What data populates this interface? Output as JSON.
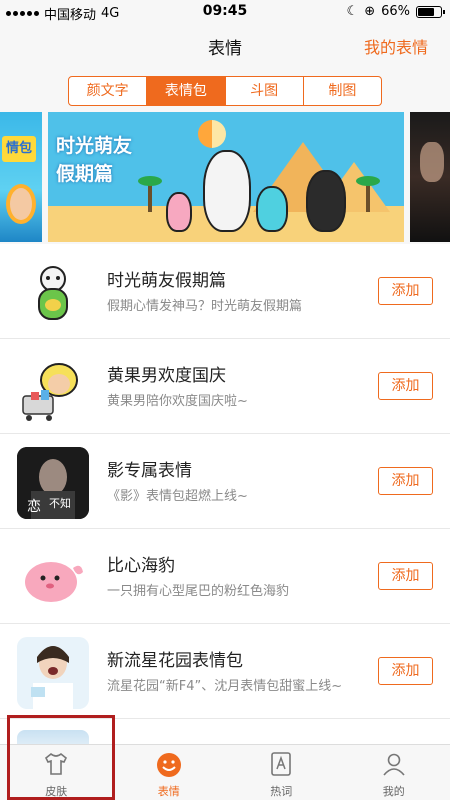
{
  "status_bar": {
    "carrier": "中国移动",
    "network": "4G",
    "time": "09:45",
    "battery": "66%"
  },
  "nav": {
    "title": "表情",
    "right_link": "我的表情"
  },
  "tabs": [
    {
      "label": "颜文字",
      "active": false
    },
    {
      "label": "表情包",
      "active": true
    },
    {
      "label": "斗图",
      "active": false
    },
    {
      "label": "制图",
      "active": false
    }
  ],
  "banner": {
    "left_tag": "情包",
    "headline": "时光萌友\n假期篇"
  },
  "list": [
    {
      "name": "时光萌友假期篇",
      "desc": "假期心情发神马？时光萌友假期篇",
      "button": "添加"
    },
    {
      "name": "黄果男欢度国庆",
      "desc": "黄果男陪你欢度国庆啦~",
      "button": "添加"
    },
    {
      "name": "影专属表情",
      "desc": "《影》表情包超燃上线~",
      "button": "添加"
    },
    {
      "name": "比心海豹",
      "desc": "一只拥有心型尾巴的粉红色海豹",
      "button": "添加"
    },
    {
      "name": "新流星花园表情包",
      "desc": "流星花园“新F4”、沈月表情包甜蜜上线~",
      "button": "添加"
    }
  ],
  "thumb_text": {
    "movie": "恋",
    "movie2": "不知"
  },
  "tabbar": [
    {
      "label": "皮肤",
      "icon": "tshirt-icon",
      "active": false
    },
    {
      "label": "表情",
      "icon": "smile-icon",
      "active": true
    },
    {
      "label": "热词",
      "icon": "hotword-icon",
      "active": false
    },
    {
      "label": "我的",
      "icon": "person-icon",
      "active": false
    }
  ],
  "colors": {
    "accent": "#ef6a1e",
    "highlight_frame": "#b01e1e"
  }
}
